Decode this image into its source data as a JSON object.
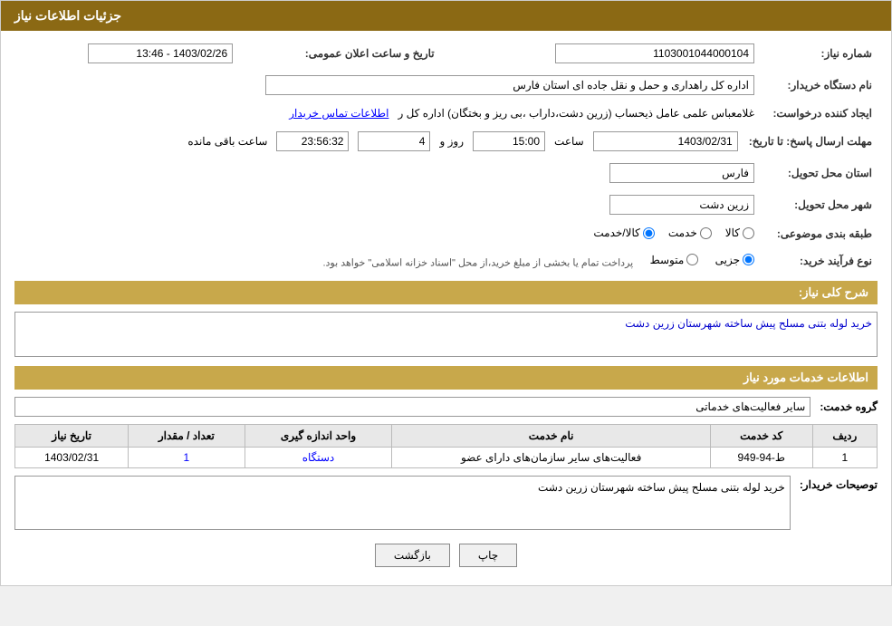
{
  "page": {
    "title": "جزئیات اطلاعات نیاز"
  },
  "header": {
    "title": "جزئیات اطلاعات نیاز"
  },
  "fields": {
    "need_number_label": "شماره نیاز:",
    "need_number_value": "1103001044000104",
    "announce_date_label": "تاریخ و ساعت اعلان عمومی:",
    "announce_date_value": "1403/02/26 - 13:46",
    "buyer_org_label": "نام دستگاه خریدار:",
    "buyer_org_value": "اداره کل راهداری و حمل و نقل جاده ای استان فارس",
    "creator_label": "ایجاد کننده درخواست:",
    "creator_value": "غلامعباس علمی عامل ذیحساب (زرین دشت،داراب ،بی ریز و بختگان) اداره کل ر",
    "creator_link": "اطلاعات تماس خریدار",
    "deadline_label": "مهلت ارسال پاسخ: تا تاریخ:",
    "deadline_date": "1403/02/31",
    "deadline_time_label": "ساعت",
    "deadline_time": "15:00",
    "deadline_day_label": "روز و",
    "deadline_days": "4",
    "deadline_countdown": "23:56:32",
    "deadline_remaining_label": "ساعت باقی مانده",
    "province_label": "استان محل تحویل:",
    "province_value": "فارس",
    "city_label": "شهر محل تحویل:",
    "city_value": "زرین دشت",
    "category_label": "طبقه بندی موضوعی:",
    "category_options": [
      "کالا",
      "خدمت",
      "کالا/خدمت"
    ],
    "category_selected": "کالا",
    "purchase_type_label": "نوع فرآیند خرید:",
    "purchase_type_options": [
      "جزیی",
      "متوسط"
    ],
    "purchase_type_selected": "جزیی",
    "purchase_type_note": "پرداخت تمام یا بخشی از مبلغ خرید،از محل \"اسناد خزانه اسلامی\" خواهد بود.",
    "need_desc_label": "شرح کلی نیاز:",
    "need_desc_value": "خرید لوله بتنی مسلح پیش ساخته شهرستان زرین دشت",
    "services_section_label": "اطلاعات خدمات مورد نیاز",
    "service_group_label": "گروه خدمت:",
    "service_group_value": "سایر فعالیت‌های خدماتی",
    "table": {
      "headers": [
        "ردیف",
        "کد خدمت",
        "نام خدمت",
        "واحد اندازه گیری",
        "تعداد / مقدار",
        "تاریخ نیاز"
      ],
      "rows": [
        {
          "row_num": "1",
          "service_code": "ط-94-949",
          "service_name": "فعالیت‌های سایر سازمان‌های دارای عضو",
          "unit": "دستگاه",
          "quantity": "1",
          "date": "1403/02/31"
        }
      ]
    },
    "buyer_desc_label": "توصیحات خریدار:",
    "buyer_desc_value": "خرید لوله بتنی مسلح پیش ساخته شهرستان زرین دشت"
  },
  "buttons": {
    "print": "چاپ",
    "back": "بازگشت"
  }
}
